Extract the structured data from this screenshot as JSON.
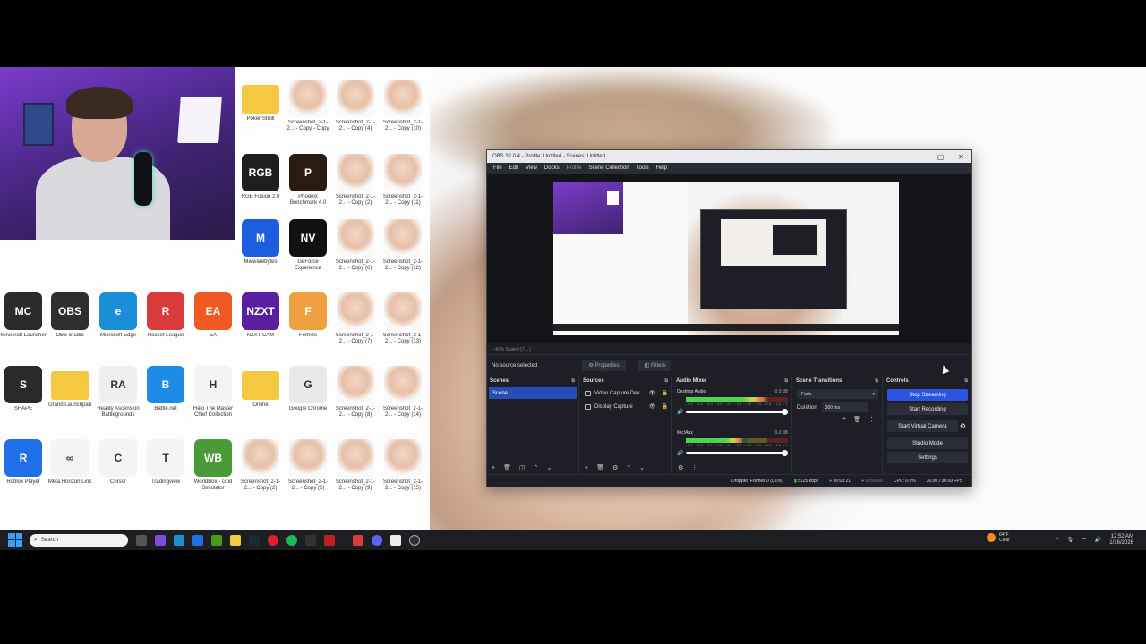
{
  "desktop": {
    "icons": [
      {
        "label": "Poker Stroll",
        "kind": "folder",
        "color": "#f5c842"
      },
      {
        "label": "Screenshot_2-1-2... - Copy - Copy",
        "kind": "person"
      },
      {
        "label": "Screenshot_2-1-2... - Copy (4)",
        "kind": "person"
      },
      {
        "label": "Screenshot_2-1-2... - Copy (10)",
        "kind": "person"
      },
      {
        "label": "RGB Fusion 2.0",
        "kind": "app",
        "color": "#1e1e1e",
        "text": "RGB"
      },
      {
        "label": "Phoenix Benchmark 4.0",
        "kind": "app",
        "color": "#2a1a10",
        "text": "P"
      },
      {
        "label": "Screenshot_2-1-2... - Copy (2)",
        "kind": "person"
      },
      {
        "label": "Screenshot_2-1-2... - Copy (11)",
        "kind": "person"
      },
      {
        "label": "Malwarebytes",
        "kind": "app",
        "color": "#1b5fe0",
        "text": "M"
      },
      {
        "label": "GeForce Experience",
        "kind": "app",
        "color": "#111",
        "text": "NV"
      },
      {
        "label": "Screenshot_2-1-2... - Copy (6)",
        "kind": "person"
      },
      {
        "label": "Screenshot_2-1-2... - Copy (12)",
        "kind": "person"
      },
      {
        "label": "Minecraft Launcher",
        "kind": "app",
        "color": "#2b2b2b",
        "text": "MC"
      },
      {
        "label": "OBS Studio",
        "kind": "app",
        "color": "#302e31",
        "text": "OBS"
      },
      {
        "label": "Microsoft Edge",
        "kind": "app",
        "color": "#1a8fd8",
        "text": "e"
      },
      {
        "label": "Rocket League",
        "kind": "app",
        "color": "#d93a3a",
        "text": "R"
      },
      {
        "label": "EA",
        "kind": "app",
        "color": "#f05a22",
        "text": "EA"
      },
      {
        "label": "NZXT CAM",
        "kind": "app",
        "color": "#5a1fa0",
        "text": "NZXT"
      },
      {
        "label": "Fortnite",
        "kind": "app",
        "color": "#f0a040",
        "text": "F"
      },
      {
        "label": "Screenshot_2-1-2... - Copy (7)",
        "kind": "person"
      },
      {
        "label": "Screenshot_2-1-2... - Copy (13)",
        "kind": "person"
      },
      {
        "label": "SHAPE",
        "kind": "app",
        "color": "#2a2a2a",
        "text": "S"
      },
      {
        "label": "Grand Launchpad",
        "kind": "folder",
        "color": "#f5c842"
      },
      {
        "label": "Reality Ascension Battlegrounds",
        "kind": "app",
        "color": "#efefef",
        "text": "RA"
      },
      {
        "label": "Battle.net",
        "kind": "app",
        "color": "#1d8ce8",
        "text": "B"
      },
      {
        "label": "Halo The Master Chief Collection",
        "kind": "app",
        "color": "#f4f4f4",
        "text": "H"
      },
      {
        "label": "Online",
        "kind": "folder",
        "color": "#f5c842"
      },
      {
        "label": "Google Chrome",
        "kind": "app",
        "color": "#e8e8e8",
        "text": "G"
      },
      {
        "label": "Screenshot_2-1-2... - Copy (8)",
        "kind": "person"
      },
      {
        "label": "Screenshot_2-1-2... - Copy (14)",
        "kind": "person"
      },
      {
        "label": "Roblox Player",
        "kind": "app",
        "color": "#1f6fe8",
        "text": "R"
      },
      {
        "label": "Meta Horizon Link",
        "kind": "app",
        "color": "#f4f4f4",
        "text": "∞"
      },
      {
        "label": "Cursor",
        "kind": "app",
        "color": "#f4f4f4",
        "text": "C"
      },
      {
        "label": "Tradingview",
        "kind": "app",
        "color": "#f4f4f4",
        "text": "T"
      },
      {
        "label": "WorldBox - God Simulator",
        "kind": "app",
        "color": "#4a9a3a",
        "text": "WB"
      },
      {
        "label": "Screenshot_2-1-2... - Copy (2)",
        "kind": "person"
      },
      {
        "label": "Screenshot_2-1-2... - Copy (5)",
        "kind": "person"
      },
      {
        "label": "Screenshot_2-1-2... - Copy (9)",
        "kind": "person"
      },
      {
        "label": "Screenshot_2-1-2... - Copy (15)",
        "kind": "person"
      }
    ]
  },
  "obs": {
    "title": "OBS 32.0.4 - Profile: Untitled - Scenes: Untitled",
    "menu": [
      "File",
      "Edit",
      "View",
      "Docks",
      "Profile",
      "Scene Collection",
      "Tools",
      "Help"
    ],
    "preview_status": "- 40%  Scaled (7... ) ",
    "no_source": "No source selected",
    "properties_label": "Properties",
    "filters_label": "Filters",
    "docks": {
      "scenes": {
        "title": "Scenes",
        "items": [
          "Scene"
        ]
      },
      "sources": {
        "title": "Sources",
        "items": [
          "Video Capture Dev",
          "Display Capture"
        ]
      },
      "audio": {
        "title": "Audio Mixer",
        "channels": [
          {
            "name": "Desktop Audio",
            "db": "0.0 dB",
            "level": 0.78
          },
          {
            "name": "Mic/Aux",
            "db": "0.0 dB",
            "level": 0.55
          }
        ],
        "ticks": "-60 -55 -50 -45 -40 -35 -30 -25 -20 -15 -10 -5 0"
      },
      "transitions": {
        "title": "Scene Transitions",
        "selected": "Fade",
        "duration_label": "Duration",
        "duration_value": "300 ms"
      },
      "controls": {
        "title": "Controls",
        "stop_streaming": "Stop Streaming",
        "start_recording": "Start Recording",
        "start_virtual_camera": "Start Virtual Camera",
        "studio_mode": "Studio Mode",
        "settings": "Settings"
      }
    },
    "status": {
      "dropped": "Dropped Frames 0 (0.0%)",
      "bitrate": "5125 kbps",
      "stream_time": "00:00:21",
      "rec_time": "00:00:00",
      "cpu": "CPU: 0.6%",
      "fps": "30.00 / 30.00 FPS"
    }
  },
  "taskbar": {
    "search_placeholder": "Search",
    "weather_temp": "64°F",
    "weather_desc": "Clear",
    "time": "12:52 AM",
    "date": "1/16/2026"
  }
}
